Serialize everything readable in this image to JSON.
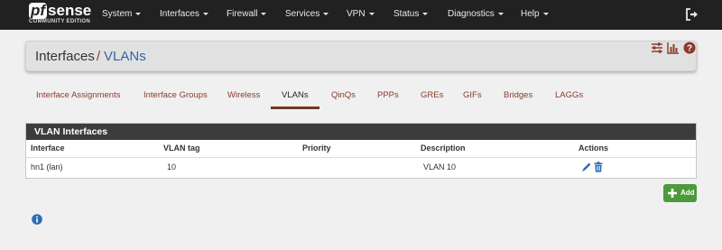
{
  "brand": {
    "name_prefix": "pf",
    "name_suffix": "sense",
    "edition": "COMMUNITY EDITION"
  },
  "navbar": {
    "items": [
      {
        "label": "System"
      },
      {
        "label": "Interfaces"
      },
      {
        "label": "Firewall"
      },
      {
        "label": "Services"
      },
      {
        "label": "VPN"
      },
      {
        "label": "Status"
      },
      {
        "label": "Diagnostics"
      },
      {
        "label": "Help"
      }
    ],
    "logout_icon": "sign-out-icon"
  },
  "header": {
    "crumb_parent": "Interfaces",
    "separator": "/",
    "crumb_current": "VLANs",
    "icons": [
      "sliders-icon",
      "bar-chart-icon",
      "question-circle-icon"
    ]
  },
  "tabs": [
    {
      "label": "Interface Assignments",
      "active": false
    },
    {
      "label": "Interface Groups",
      "active": false
    },
    {
      "label": "Wireless",
      "active": false
    },
    {
      "label": "VLANs",
      "active": true
    },
    {
      "label": "QinQs",
      "active": false
    },
    {
      "label": "PPPs",
      "active": false
    },
    {
      "label": "GREs",
      "active": false
    },
    {
      "label": "GIFs",
      "active": false
    },
    {
      "label": "Bridges",
      "active": false
    },
    {
      "label": "LAGGs",
      "active": false
    }
  ],
  "vlan_panel": {
    "title": "VLAN Interfaces",
    "columns": [
      "Interface",
      "VLAN tag",
      "Priority",
      "Description",
      "Actions"
    ],
    "rows": [
      {
        "interface": "hn1 (lan)",
        "vlan_tag": "10",
        "priority": "",
        "description": "VLAN 10",
        "actions": [
          "pencil-icon",
          "trash-icon"
        ]
      }
    ]
  },
  "add_button": {
    "label": "Add",
    "icon": "plus-icon"
  },
  "info_icon": "info-circle-icon",
  "colors": {
    "navbar_bg": "#212121",
    "link_red": "#8b3a2f",
    "link_blue": "#3366a4",
    "panel_heading": "#3c3c3c",
    "add_green": "#4c9a3b",
    "action_blue": "#2a6db3"
  }
}
